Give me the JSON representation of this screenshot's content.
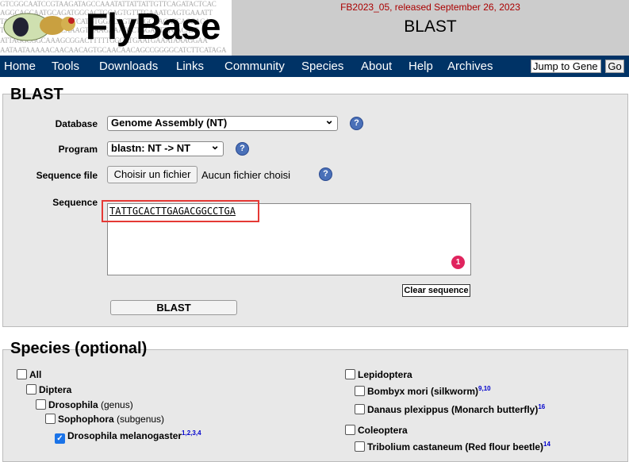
{
  "header": {
    "logo_text": "FlyBase",
    "dna_lines": [
      "GTCGGCAATCCGTAAGATAGCCAAATATTATTATTGTTCAGATACTCAC",
      "AGGCAGCAATGCAGATGGGACTGGAGTGTTTGAAATCAGTGAAATT",
      "TACAACATTAACAGTCTCATGTGGACAGTTTAGCAAGATCACGAGA",
      "TTTTGGATCATGATCAAAGTGAAGAAATGCTGGAATTTGACATT",
      "ATTAGGCGGCAAAGCGGACTTTTTGGGATGAATGAAATAAAGGAA",
      "AATAATAAAAACAACAACAGTGCAACAACAGCCGGGGCATCTTCATAGA"
    ],
    "release": "FB2023_05, released September 26, 2023",
    "page_title": "BLAST"
  },
  "nav": {
    "items": [
      "Home",
      "Tools",
      "Downloads",
      "Links",
      "Community",
      "Species",
      "About",
      "Help",
      "Archives"
    ],
    "jump_label": "Jump to Gene",
    "go_label": "Go"
  },
  "blast": {
    "legend": "BLAST",
    "database_label": "Database",
    "database_value": "Genome Assembly (NT)",
    "program_label": "Program",
    "program_value": "blastn: NT -> NT",
    "seqfile_label": "Sequence file",
    "choose_file": "Choisir un fichier",
    "no_file": "Aucun fichier choisi",
    "sequence_label": "Sequence",
    "sequence_value": "TATTGCACTTGAGACGGCCTGA",
    "badge": "1",
    "clear_label": "Clear sequence",
    "blast_button": "BLAST",
    "help": "?"
  },
  "species": {
    "legend": "Species (optional)",
    "left": [
      {
        "name": "All",
        "extra": "",
        "sup": "",
        "checked": false
      },
      {
        "name": "Diptera",
        "extra": "",
        "sup": "",
        "checked": false
      },
      {
        "name": "Drosophila",
        "extra": " (genus)",
        "sup": "",
        "checked": false
      },
      {
        "name": "Sophophora",
        "extra": " (subgenus)",
        "sup": "",
        "checked": false
      },
      {
        "name": "Drosophila melanogaster",
        "extra": "",
        "sup": "1,2,3,4",
        "checked": true
      }
    ],
    "right": [
      {
        "name": "Lepidoptera",
        "extra": "",
        "sup": "",
        "checked": false
      },
      {
        "name": "Bombyx mori (silkworm)",
        "extra": "",
        "sup": "9,10",
        "checked": false
      },
      {
        "name": "Danaus plexippus (Monarch butterfly)",
        "extra": "",
        "sup": "16",
        "checked": false
      },
      {
        "name": "Coleoptera",
        "extra": "",
        "sup": "",
        "checked": false
      },
      {
        "name": "Tribolium castaneum (Red flour beetle)",
        "extra": "",
        "sup": "14",
        "checked": false
      }
    ]
  },
  "colors": {
    "nav_bg": "#003366",
    "header_bg": "#cccccc",
    "release_text": "#aa0000",
    "highlight_box": "#e53935"
  }
}
